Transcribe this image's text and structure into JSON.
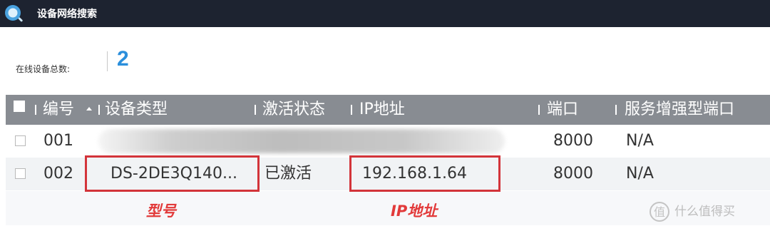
{
  "window": {
    "title": "设备网络搜索"
  },
  "summary": {
    "label": "在线设备总数:",
    "count": "2"
  },
  "table": {
    "columns": [
      "编号",
      "设备类型",
      "激活状态",
      "IP地址",
      "端口",
      "服务增强型端口"
    ],
    "rows": [
      {
        "no": "001",
        "type": "",
        "status": "",
        "ip": "",
        "port": "8000",
        "enhanced_port": "N/A"
      },
      {
        "no": "002",
        "type": "DS-2DE3Q140...",
        "status": "已激活",
        "ip": "192.168.1.64",
        "port": "8000",
        "enhanced_port": "N/A"
      }
    ]
  },
  "annotations": {
    "model_label": "型号",
    "ip_label": "IP地址"
  },
  "watermark": {
    "text": "什么值得买"
  },
  "colors": {
    "titlebar": "#1d2330",
    "header": "#888c92",
    "count": "#2b8fdc",
    "highlight": "#d3343a"
  }
}
